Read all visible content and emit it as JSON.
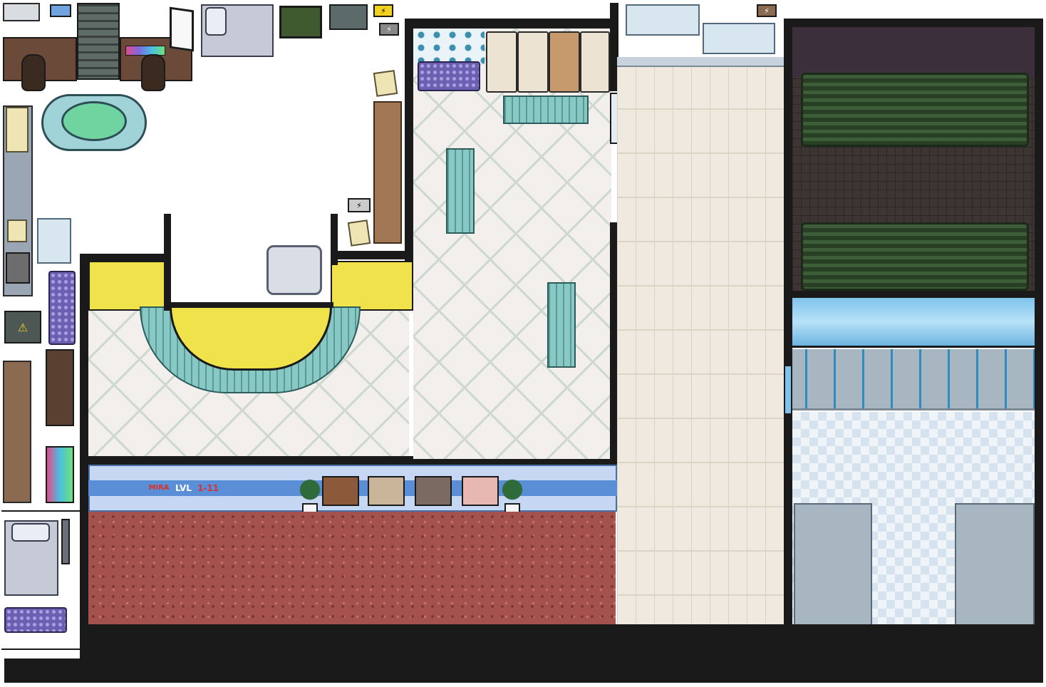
{
  "banner": {
    "logo_text": "MIRA",
    "level_label": "LVL",
    "level_value": "1-11"
  },
  "colors": {
    "wall": "#1a1a1a",
    "banner_blue": "#5a8fd8",
    "level_red": "#d9322b",
    "yellow_pad": "#f0e24a",
    "teal_mat": "#6fb3b0",
    "carpet_red": "#a5524f"
  },
  "icons": [
    "mira-logo-icon",
    "lightning-icon",
    "potted-plant-icon",
    "photo-frame-icon",
    "warning-icon"
  ]
}
